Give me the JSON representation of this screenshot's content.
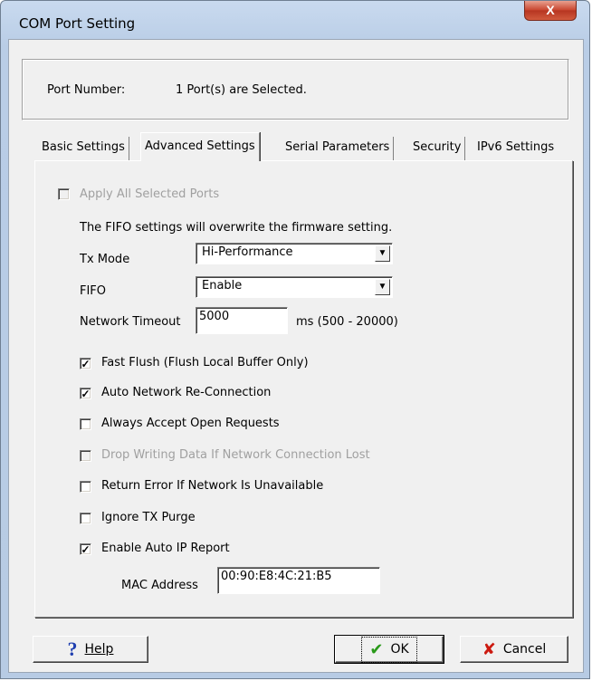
{
  "window": {
    "title": "COM Port Setting",
    "close_glyph": "X"
  },
  "port": {
    "label": "Port Number:",
    "value": "1 Port(s) are Selected."
  },
  "tabs": [
    {
      "label": "Basic Settings",
      "active": false
    },
    {
      "label": "Advanced Settings",
      "active": true
    },
    {
      "label": "Serial Parameters",
      "active": false
    },
    {
      "label": "Security",
      "active": false
    },
    {
      "label": "IPv6 Settings",
      "active": false
    }
  ],
  "advanced": {
    "apply_all": {
      "label": "Apply All Selected Ports",
      "checked": false,
      "enabled": false
    },
    "fifo_note": "The FIFO settings will overwrite the firmware setting.",
    "tx_mode": {
      "label": "Tx Mode",
      "value": "Hi-Performance"
    },
    "fifo": {
      "label": "FIFO",
      "value": "Enable"
    },
    "network_timeout": {
      "label": "Network Timeout",
      "value": "5000",
      "range": "ms (500 - 20000)"
    },
    "options": [
      {
        "label": "Fast Flush (Flush Local Buffer Only)",
        "checked": true,
        "enabled": true
      },
      {
        "label": "Auto Network Re-Connection",
        "checked": true,
        "enabled": true
      },
      {
        "label": "Always Accept Open Requests",
        "checked": false,
        "enabled": true
      },
      {
        "label": "Drop Writing Data If Network Connection Lost",
        "checked": false,
        "enabled": false
      },
      {
        "label": "Return Error If Network Is Unavailable",
        "checked": false,
        "enabled": true
      },
      {
        "label": "Ignore TX Purge",
        "checked": false,
        "enabled": true
      },
      {
        "label": "Enable Auto IP Report",
        "checked": true,
        "enabled": true
      }
    ],
    "mac_address": {
      "label": "MAC Address",
      "value": "00:90:E8:4C:21:B5"
    }
  },
  "buttons": {
    "help": {
      "glyph": "?",
      "label": "Help",
      "icon": "help-question-icon"
    },
    "ok": {
      "glyph": "✔",
      "label": "OK",
      "icon": "checkmark-icon"
    },
    "cancel": {
      "glyph": "✘",
      "label": "Cancel",
      "icon": "cross-icon"
    }
  },
  "colors": {
    "help_icon": "#1f3fb0",
    "ok_icon": "#2a9a1a",
    "cancel_icon": "#cc1a10",
    "close_button": "#c8432c"
  }
}
